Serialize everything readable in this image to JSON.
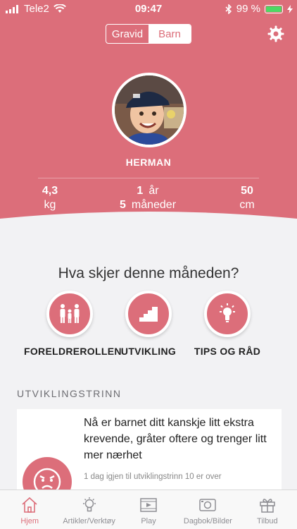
{
  "status_bar": {
    "carrier": "Tele2",
    "time": "09:47",
    "battery_percent": "99 %"
  },
  "toggle": {
    "left_label": "Gravid",
    "right_label": "Barn",
    "selected": "Barn"
  },
  "profile": {
    "name": "HERMAN",
    "weight_value": "4,3",
    "weight_unit": "kg",
    "age_years": "1",
    "age_years_unit": "år",
    "age_months": "5",
    "age_months_unit": "måneder",
    "height_value": "50",
    "height_unit": "cm"
  },
  "question": "Hva skjer denne måneden?",
  "categories": [
    {
      "label": "FORELDREROLLEN",
      "icon": "parents-icon"
    },
    {
      "label": "UTVIKLING",
      "icon": "stairs-icon"
    },
    {
      "label": "TIPS OG RÅD",
      "icon": "lightbulb-icon"
    }
  ],
  "section": {
    "title": "UTVIKLINGSTRINN",
    "card_text": "Nå er barnet ditt kanskje litt ekstra krevende, gråter oftere og trenger litt mer nærhet",
    "card_subtext": "1 dag igjen til utviklingstrinn 10 er over"
  },
  "tabs": [
    {
      "label": "Hjem",
      "icon": "home-icon",
      "active": true
    },
    {
      "label": "Artikler/Verktøy",
      "icon": "lightbulb-icon",
      "active": false
    },
    {
      "label": "Play",
      "icon": "play-icon",
      "active": false
    },
    {
      "label": "Dagbok/Bilder",
      "icon": "camera-icon",
      "active": false
    },
    {
      "label": "Tilbud",
      "icon": "gift-icon",
      "active": false
    }
  ],
  "colors": {
    "accent": "#dc6e7a",
    "battery": "#4cd964"
  }
}
